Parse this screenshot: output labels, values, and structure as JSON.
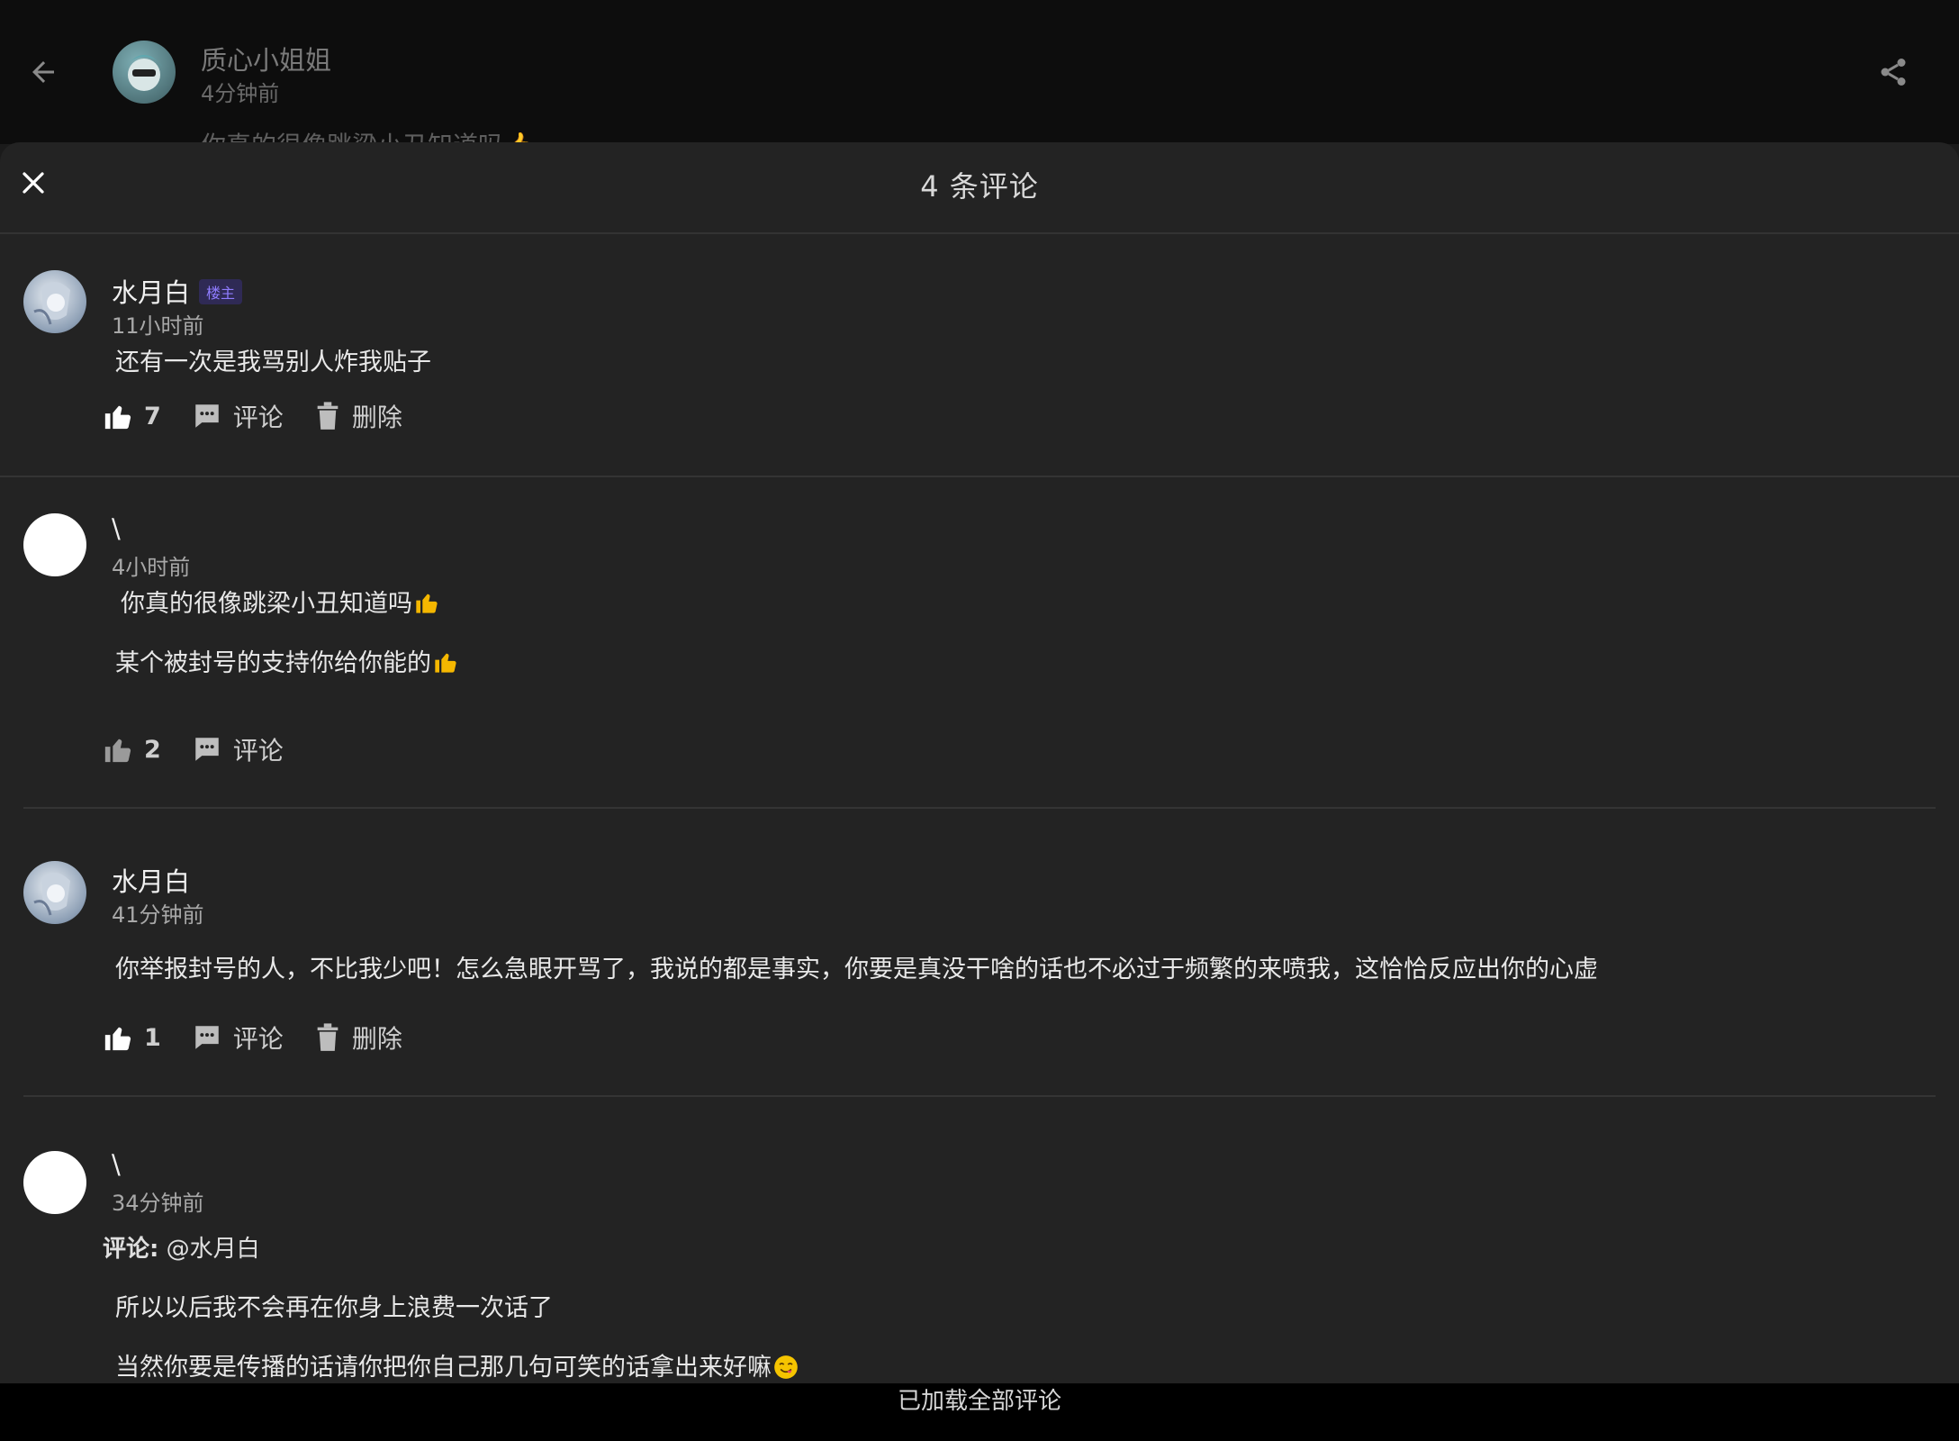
{
  "topbar": {
    "author_name": "质心小姐姐",
    "author_time": "4分钟前",
    "peek_text": "你真的很像跳梁小丑知道吗👍"
  },
  "sheet": {
    "title": "4 条评论"
  },
  "comments": [
    {
      "user": "水月白",
      "badge": "楼主",
      "time": "11小时前",
      "lines": [
        "还有一次是我骂别人炸我贴子"
      ],
      "likes": "7",
      "comment_label": "评论",
      "delete_label": "删除"
    },
    {
      "user": "\\",
      "time": "4小时前",
      "lines": [
        "你真的很像跳梁小丑知道吗",
        "某个被封号的支持你给你能的"
      ],
      "likes": "2",
      "comment_label": "评论"
    },
    {
      "user": "水月白",
      "time": "41分钟前",
      "lines": [
        "你举报封号的人，不比我少吧！怎么急眼开骂了，我说的都是事实，你要是真没干啥的话也不必过于频繁的来喷我，这恰恰反应出你的心虚"
      ],
      "likes": "1",
      "comment_label": "评论",
      "delete_label": "删除"
    },
    {
      "user": "\\",
      "time": "34分钟前",
      "reply_label": "评论:",
      "reply_to": "@水月白",
      "lines": [
        "所以以后我不会再在你身上浪费一次话了",
        "当然你要是传播的话请你把你自己那几句可笑的话拿出来好嘛"
      ]
    }
  ],
  "footer": {
    "text": "已加载全部评论"
  },
  "colors": {
    "background": "#232323",
    "topbar": "#0d0d0d",
    "badge": "#8f7cff",
    "footer": "#000000"
  }
}
